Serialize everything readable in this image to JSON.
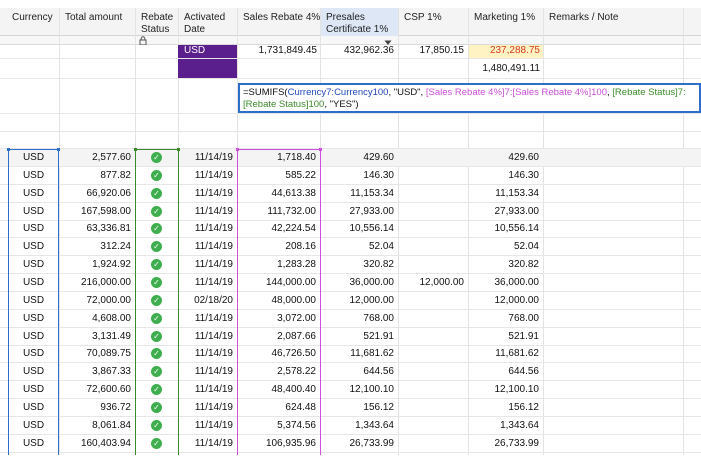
{
  "columns": [
    {
      "id": "currency",
      "label": "Currency"
    },
    {
      "id": "total_amount",
      "label": "Total amount"
    },
    {
      "id": "rebate_status",
      "label": "Rebate Status"
    },
    {
      "id": "activated_date",
      "label": "Activated Date"
    },
    {
      "id": "sales_rebate",
      "label": "Sales Rebate 4%"
    },
    {
      "id": "presales",
      "label": "Presales Certificate 1%"
    },
    {
      "id": "csp",
      "label": "CSP 1%"
    },
    {
      "id": "marketing",
      "label": "Marketing 1%"
    },
    {
      "id": "remarks",
      "label": "Remarks / Note"
    }
  ],
  "summary": {
    "currency_badge": "USD",
    "sales_rebate": "1,731,849.45",
    "presales": "432,962.36",
    "csp": "17,850.15",
    "marketing": "237,288.75",
    "marketing_second": "1,480,491.11"
  },
  "formula": {
    "part1": "=SUMIFS(",
    "part2": "Currency7:Currency100",
    "part3": ", \"USD\", ",
    "part4": "[Sales Rebate 4%]7:[Sales Rebate 4%]100",
    "part5": ", ",
    "part6": "[Rebate Status]7:[Rebate Status]100",
    "part7": ", \"YES\")"
  },
  "rows": [
    {
      "currency": "USD",
      "total": "2,577.60",
      "date": "11/14/19",
      "sales": "1,718.40",
      "presales": "429.60",
      "csp": "",
      "marketing": "429.60"
    },
    {
      "currency": "USD",
      "total": "877.82",
      "date": "11/14/19",
      "sales": "585.22",
      "presales": "146.30",
      "csp": "",
      "marketing": "146.30"
    },
    {
      "currency": "USD",
      "total": "66,920.06",
      "date": "11/14/19",
      "sales": "44,613.38",
      "presales": "11,153.34",
      "csp": "",
      "marketing": "11,153.34"
    },
    {
      "currency": "USD",
      "total": "167,598.00",
      "date": "11/14/19",
      "sales": "111,732.00",
      "presales": "27,933.00",
      "csp": "",
      "marketing": "27,933.00"
    },
    {
      "currency": "USD",
      "total": "63,336.81",
      "date": "11/14/19",
      "sales": "42,224.54",
      "presales": "10,556.14",
      "csp": "",
      "marketing": "10,556.14"
    },
    {
      "currency": "USD",
      "total": "312.24",
      "date": "11/14/19",
      "sales": "208.16",
      "presales": "52.04",
      "csp": "",
      "marketing": "52.04"
    },
    {
      "currency": "USD",
      "total": "1,924.92",
      "date": "11/14/19",
      "sales": "1,283.28",
      "presales": "320.82",
      "csp": "",
      "marketing": "320.82"
    },
    {
      "currency": "USD",
      "total": "216,000.00",
      "date": "11/14/19",
      "sales": "144,000.00",
      "presales": "36,000.00",
      "csp": "12,000.00",
      "marketing": "36,000.00"
    },
    {
      "currency": "USD",
      "total": "72,000.00",
      "date": "02/18/20",
      "sales": "48,000.00",
      "presales": "12,000.00",
      "csp": "",
      "marketing": "12,000.00"
    },
    {
      "currency": "USD",
      "total": "4,608.00",
      "date": "11/14/19",
      "sales": "3,072.00",
      "presales": "768.00",
      "csp": "",
      "marketing": "768.00"
    },
    {
      "currency": "USD",
      "total": "3,131.49",
      "date": "11/14/19",
      "sales": "2,087.66",
      "presales": "521.91",
      "csp": "",
      "marketing": "521.91"
    },
    {
      "currency": "USD",
      "total": "70,089.75",
      "date": "11/14/19",
      "sales": "46,726.50",
      "presales": "11,681.62",
      "csp": "",
      "marketing": "11,681.62"
    },
    {
      "currency": "USD",
      "total": "3,867.33",
      "date": "11/14/19",
      "sales": "2,578.22",
      "presales": "644.56",
      "csp": "",
      "marketing": "644.56"
    },
    {
      "currency": "USD",
      "total": "72,600.60",
      "date": "11/14/19",
      "sales": "48,400.40",
      "presales": "12,100.10",
      "csp": "",
      "marketing": "12,100.10"
    },
    {
      "currency": "USD",
      "total": "936.72",
      "date": "11/14/19",
      "sales": "624.48",
      "presales": "156.12",
      "csp": "",
      "marketing": "156.12"
    },
    {
      "currency": "USD",
      "total": "8,061.84",
      "date": "11/14/19",
      "sales": "5,374.56",
      "presales": "1,343.64",
      "csp": "",
      "marketing": "1,343.64"
    },
    {
      "currency": "USD",
      "total": "160,403.94",
      "date": "11/14/19",
      "sales": "106,935.96",
      "presales": "26,733.99",
      "csp": "",
      "marketing": "26,733.99"
    }
  ],
  "colors": {
    "currency_range": "#2d6ec9",
    "rebate_range": "#3a8a2a",
    "sales_range": "#d14fe0",
    "summary_purple": "#5a1f8c",
    "marketing_summary_bg": "#fff3c4",
    "marketing_summary_text": "#d63a1f"
  },
  "icons": {
    "lock": "lock-icon",
    "dropdown": "dropdown-arrow-icon",
    "check": "check-circle-icon"
  }
}
